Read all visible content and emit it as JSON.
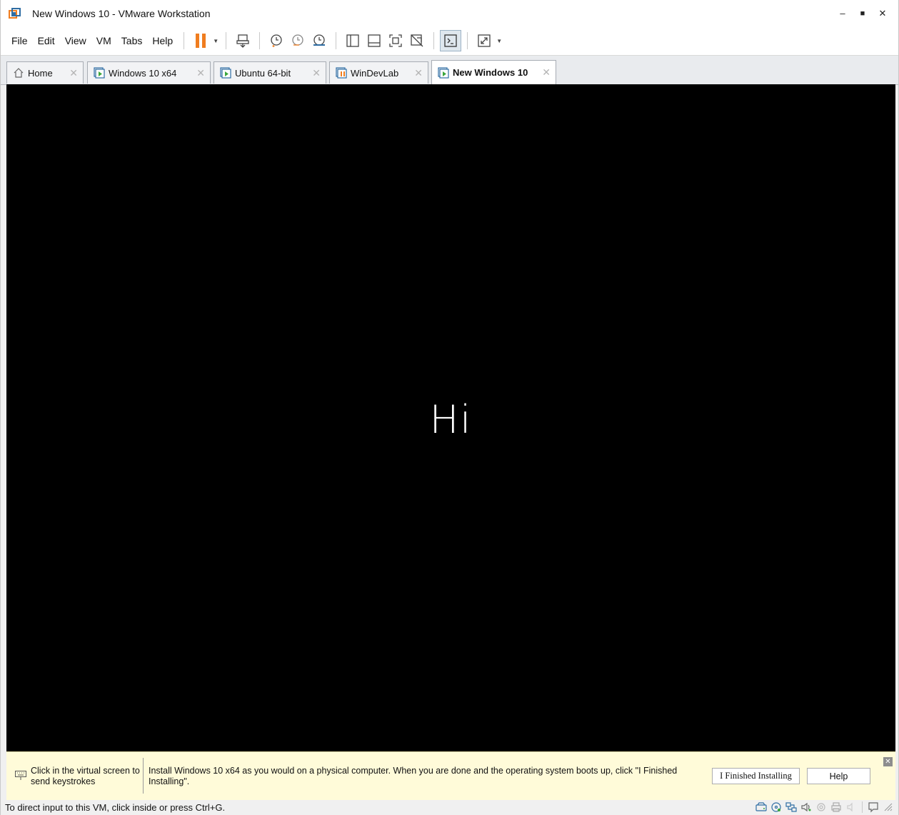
{
  "window": {
    "title": "New Windows 10 - VMware Workstation",
    "minimize_glyph": "–",
    "maximize_glyph": "■",
    "close_glyph": "✕"
  },
  "menu": {
    "items": [
      "File",
      "Edit",
      "View",
      "VM",
      "Tabs",
      "Help"
    ]
  },
  "toolbar": {
    "icons": [
      "pause-icon",
      "send-ctrl-alt-del-icon",
      "take-snapshot-icon",
      "revert-snapshot-icon",
      "snapshot-manager-icon",
      "show-library-icon",
      "show-thumbnail-bar-icon",
      "full-screen-icon",
      "unity-icon",
      "console-view-icon",
      "stretch-guest-icon"
    ]
  },
  "tabs": [
    {
      "label": "Home",
      "icon": "home-icon",
      "active": false
    },
    {
      "label": "Windows 10 x64",
      "icon": "vm-running-icon",
      "active": false
    },
    {
      "label": "Ubuntu 64-bit",
      "icon": "vm-running-icon",
      "active": false
    },
    {
      "label": "WinDevLab",
      "icon": "vm-paused-icon",
      "active": false
    },
    {
      "label": "New Windows 10",
      "icon": "vm-running-icon",
      "active": true
    }
  ],
  "tab_close_glyph": "✕",
  "vm_screen": {
    "text": "Hi"
  },
  "hint_bar": {
    "left_text": "Click in the virtual screen to send keystrokes",
    "message": "Install Windows 10 x64 as you would on a physical computer. When you are done and the operating system boots up, click \"I Finished Installing\".",
    "finished_button": "I Finished Installing",
    "help_button": "Help",
    "close_glyph": "✕"
  },
  "status_bar": {
    "text": "To direct input to this VM, click inside or press Ctrl+G.",
    "icons": [
      "hard-disk-icon",
      "cd-dvd-icon",
      "network-adapter-icon",
      "sound-card-icon",
      "usb-controller-icon",
      "printer-icon",
      "display-icon",
      "message-log-icon",
      "resize-grip-icon"
    ]
  },
  "colors": {
    "accent_orange": "#f07d1f",
    "vm_background": "#000000",
    "hint_background": "#fffbd9",
    "icon_blue": "#2f6da3"
  }
}
